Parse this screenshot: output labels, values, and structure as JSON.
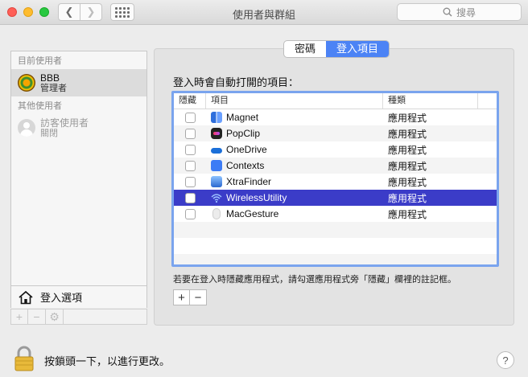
{
  "window": {
    "title": "使用者與群組",
    "search_placeholder": "搜尋"
  },
  "sidebar": {
    "current_users_header": "目前使用者",
    "current_user": {
      "name": "BBB",
      "role": "管理者"
    },
    "other_users_header": "其他使用者",
    "guest_user": {
      "name": "訪客使用者",
      "status": "關閉"
    },
    "login_options_label": "登入選項",
    "tools": {
      "add": "+",
      "remove": "−",
      "gear": "⚙"
    }
  },
  "tabs": [
    {
      "label": "密碼",
      "active": false
    },
    {
      "label": "登入項目",
      "active": true
    }
  ],
  "login_items": {
    "label": "登入時會自動打開的項目：",
    "columns": {
      "hide": "隱藏",
      "item": "項目",
      "kind": "種類"
    },
    "rows": [
      {
        "name": "Magnet",
        "kind": "應用程式",
        "hidden": false,
        "icon": "magnet-icon"
      },
      {
        "name": "PopClip",
        "kind": "應用程式",
        "hidden": false,
        "icon": "popclip-icon"
      },
      {
        "name": "OneDrive",
        "kind": "應用程式",
        "hidden": false,
        "icon": "onedrive-icon"
      },
      {
        "name": "Contexts",
        "kind": "應用程式",
        "hidden": false,
        "icon": "contexts-icon"
      },
      {
        "name": "XtraFinder",
        "kind": "應用程式",
        "hidden": false,
        "icon": "xtrafinder-icon"
      },
      {
        "name": "WirelessUtility",
        "kind": "應用程式",
        "hidden": false,
        "icon": "wifi-icon",
        "selected": true
      },
      {
        "name": "MacGesture",
        "kind": "應用程式",
        "hidden": false,
        "icon": "macgesture-icon"
      }
    ],
    "hint": "若要在登入時隱藏應用程式，請勾選應用程式旁「隱藏」欄裡的註記框。",
    "add_button": "+",
    "remove_button": "−"
  },
  "footer": {
    "lock_text": "按鎖頭一下，以進行更改。",
    "help_label": "?"
  },
  "colors": {
    "accent": "#4c83f5",
    "selection": "#3b3cc8",
    "table_focus_ring": "#7aa4ee"
  }
}
